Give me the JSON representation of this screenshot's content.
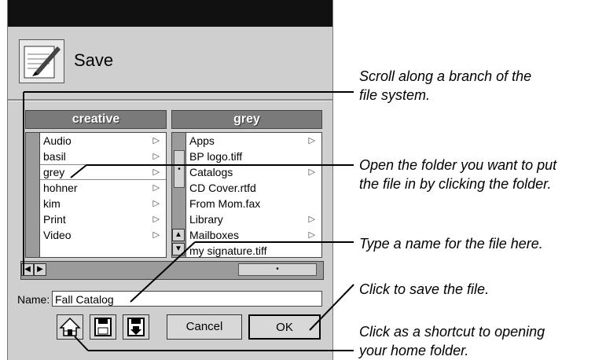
{
  "dialog": {
    "title": "Save",
    "left_column": {
      "header": "creative",
      "items": [
        {
          "label": "Audio",
          "folder": true
        },
        {
          "label": "basil",
          "folder": true
        },
        {
          "label": "grey",
          "folder": true,
          "selected": true
        },
        {
          "label": "hohner",
          "folder": true
        },
        {
          "label": "kim",
          "folder": true
        },
        {
          "label": "Print",
          "folder": true
        },
        {
          "label": "Video",
          "folder": true
        }
      ]
    },
    "right_column": {
      "header": "grey",
      "items": [
        {
          "label": "Apps",
          "folder": true
        },
        {
          "label": "BP logo.tiff",
          "folder": false
        },
        {
          "label": "Catalogs",
          "folder": true
        },
        {
          "label": "CD Cover.rtfd",
          "folder": false
        },
        {
          "label": "From Mom.fax",
          "folder": false
        },
        {
          "label": "Library",
          "folder": true
        },
        {
          "label": "Mailboxes",
          "folder": true
        },
        {
          "label": "my signature.tiff",
          "folder": false
        }
      ]
    },
    "name_label": "Name:",
    "name_value": "Fall Catalog",
    "buttons": {
      "home_icon": "home-icon",
      "disk_icon": "disk-icon",
      "disk_down_icon": "disk-arrow-icon",
      "cancel": "Cancel",
      "ok": "OK"
    }
  },
  "callouts": {
    "scroll": [
      "Scroll along a branch of the",
      "file system."
    ],
    "open": [
      "Open the folder you want to put",
      "the file in by clicking the folder."
    ],
    "name": [
      "Type a name for the file here."
    ],
    "save": [
      "Click to save the file."
    ],
    "home": [
      "Click as a shortcut to opening",
      "your home folder."
    ]
  }
}
